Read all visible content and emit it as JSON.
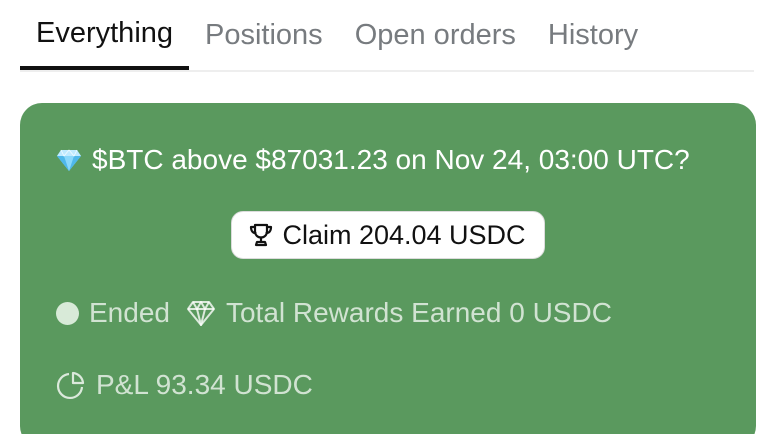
{
  "tabs": [
    {
      "label": "Everything",
      "active": true
    },
    {
      "label": "Positions",
      "active": false
    },
    {
      "label": "Open orders",
      "active": false
    },
    {
      "label": "History",
      "active": false
    }
  ],
  "card": {
    "icon": "diamond-icon",
    "question": "$BTC above $87031.23 on Nov 24, 03:00 UTC?",
    "claim_button": {
      "icon": "trophy-icon",
      "label": "Claim 204.04 USDC"
    },
    "status": {
      "icon": "status-dot-icon",
      "label": "Ended"
    },
    "rewards": {
      "icon": "diamond-outline-icon",
      "label": "Total Rewards Earned 0 USDC"
    },
    "pnl": {
      "icon": "pie-chart-icon",
      "label": "P&L 93.34 USDC"
    }
  },
  "colors": {
    "card_background": "#5a995e",
    "active_tab": "#111111",
    "inactive_tab": "#777b7f",
    "button_background": "#ffffff"
  }
}
